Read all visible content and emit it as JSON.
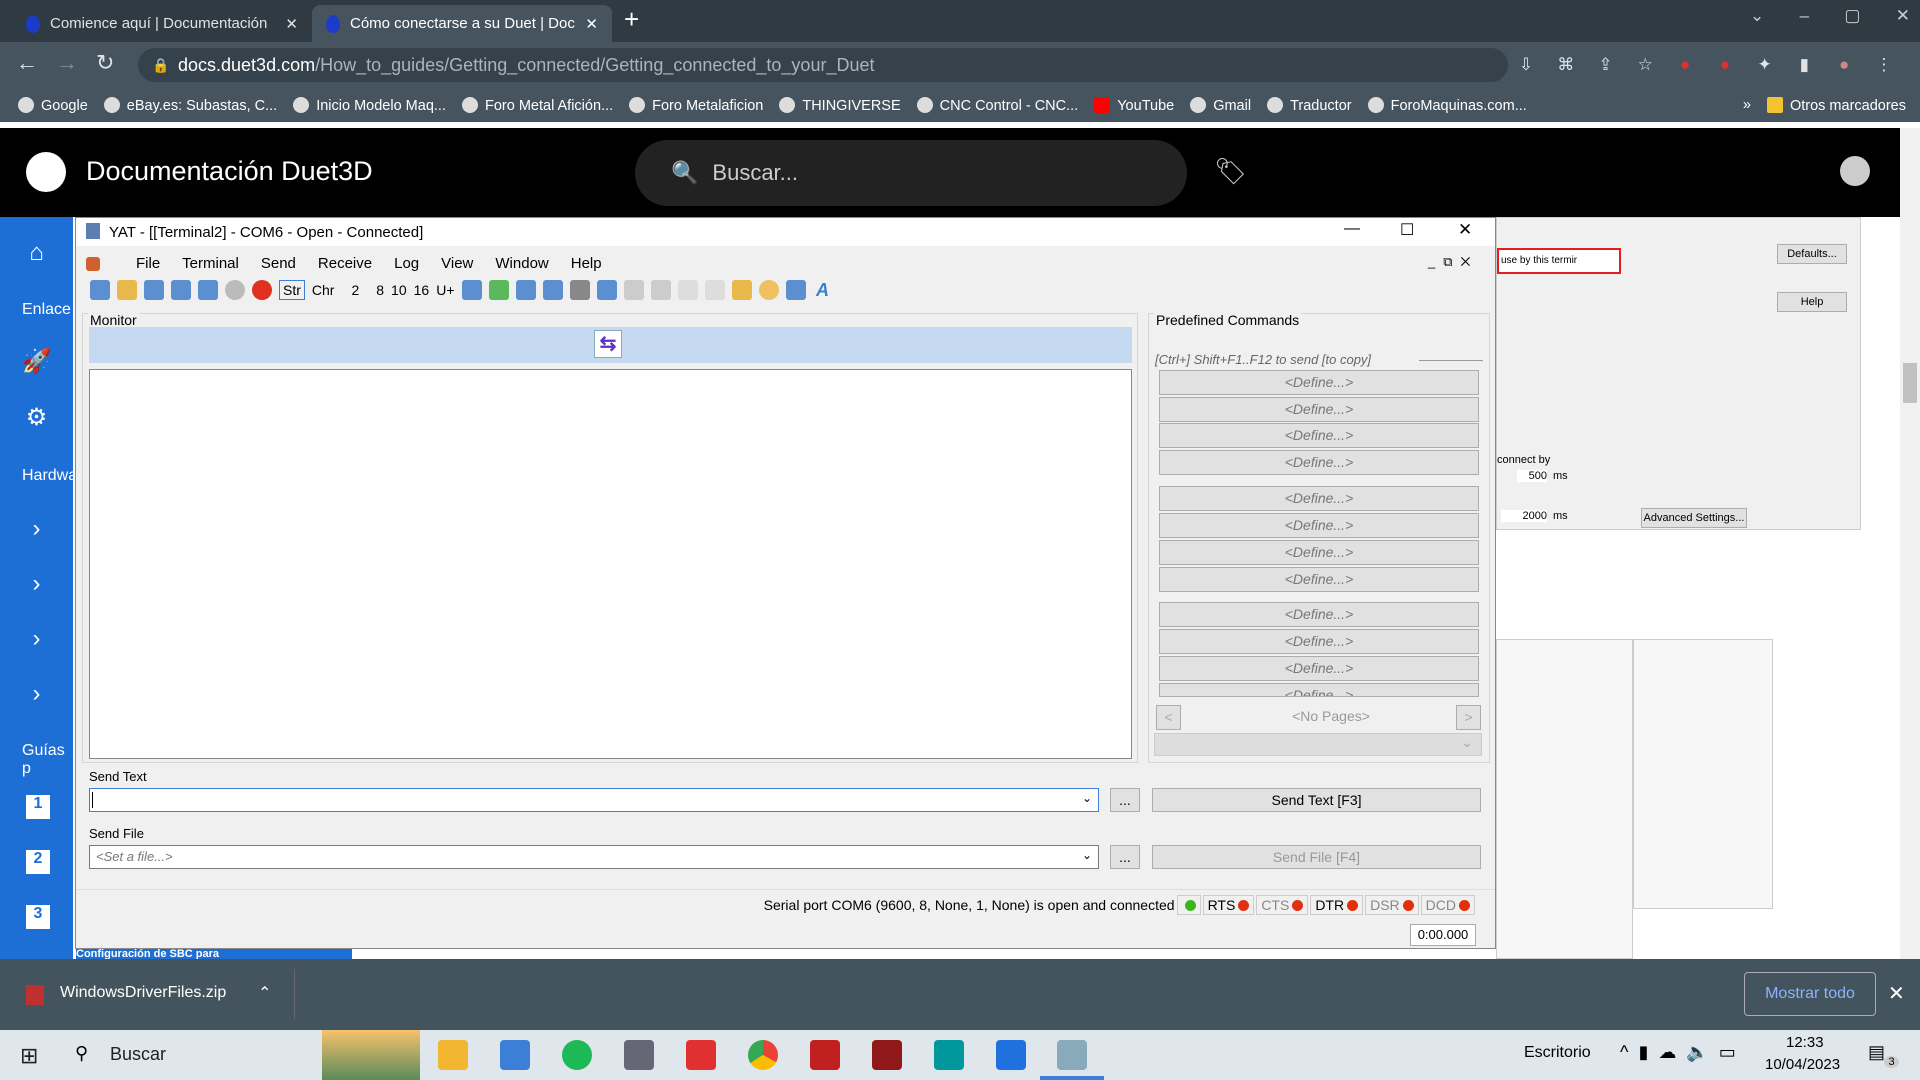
{
  "browser": {
    "tabs": [
      {
        "title": "Comience aquí | Documentación",
        "active": false
      },
      {
        "title": "Cómo conectarse a su Duet | Doc",
        "active": true
      }
    ],
    "url_domain": "docs.duet3d.com",
    "url_path": "/How_to_guides/Getting_connected/Getting_connected_to_your_Duet",
    "bookmarks": [
      "Google",
      "eBay.es: Subastas, C...",
      "Inicio Modelo Maq...",
      "Foro Metal Afición...",
      "Foro Metalaficion",
      "THINGIVERSE",
      "CNC Control - CNC...",
      "YouTube",
      "Gmail",
      "Traductor",
      "ForoMaquinas.com..."
    ],
    "bookmarks_more": "»",
    "other_bookmarks": "Otros marcadores"
  },
  "site": {
    "title": "Documentación Duet3D",
    "search_placeholder": "Buscar...",
    "sidebar_labels": [
      "Enlace",
      "Hardwa",
      "Guías p"
    ],
    "numbers": [
      "1",
      "2",
      "3"
    ],
    "bottom_link": "Configuración de SBC para"
  },
  "bg_dialog": {
    "combo": "use by this termir",
    "defaults": "Defaults...",
    "help": "Help",
    "reconnect": "connect by",
    "v1": "500",
    "v2": "2000",
    "ms": "ms",
    "advanced": "Advanced Settings..."
  },
  "yat": {
    "title": "YAT - [[Terminal2] - COM6 - Open - Connected]",
    "menu": [
      "File",
      "Terminal",
      "Send",
      "Receive",
      "Log",
      "View",
      "Window",
      "Help"
    ],
    "toolbar_radix": [
      "Str",
      "Chr",
      "2",
      "8",
      "10",
      "16",
      "U+"
    ],
    "monitor_label": "Monitor",
    "predefined": {
      "label": "Predefined Commands",
      "hint": "[Ctrl+] Shift+F1..F12 to send [to copy]",
      "commands": [
        "<Define...>",
        "<Define...>",
        "<Define...>",
        "<Define...>",
        "<Define...>",
        "<Define...>",
        "<Define...>",
        "<Define...>",
        "<Define...>",
        "<Define...>",
        "<Define...>",
        "<Define...>"
      ],
      "pages": "<No Pages>",
      "prev": "<",
      "next": ">"
    },
    "send_text": {
      "label": "Send Text",
      "value": "",
      "browse": "...",
      "button": "Send Text [F3]"
    },
    "send_file": {
      "label": "Send File",
      "placeholder": "<Set a file...>",
      "browse": "...",
      "button": "Send File [F4]"
    },
    "status": {
      "text": "Serial port COM6 (9600, 8, None, 1, None) is open and connected",
      "signals": [
        {
          "name": "RTS",
          "active": true
        },
        {
          "name": "CTS",
          "active": false
        },
        {
          "name": "DTR",
          "active": true
        },
        {
          "name": "DSR",
          "active": false
        },
        {
          "name": "DCD",
          "active": false
        }
      ],
      "timer": "0:00.000"
    },
    "colors": {
      "led_on": "#e03010",
      "led_connected": "#3cb521",
      "monitor_band": "#c5d9f1"
    }
  },
  "download": {
    "file": "WindowsDriverFiles.zip",
    "show_all": "Mostrar todo"
  },
  "taskbar": {
    "search": "Buscar",
    "desktop": "Escritorio",
    "time": "12:33",
    "date": "10/04/2023",
    "notifications": "3"
  }
}
